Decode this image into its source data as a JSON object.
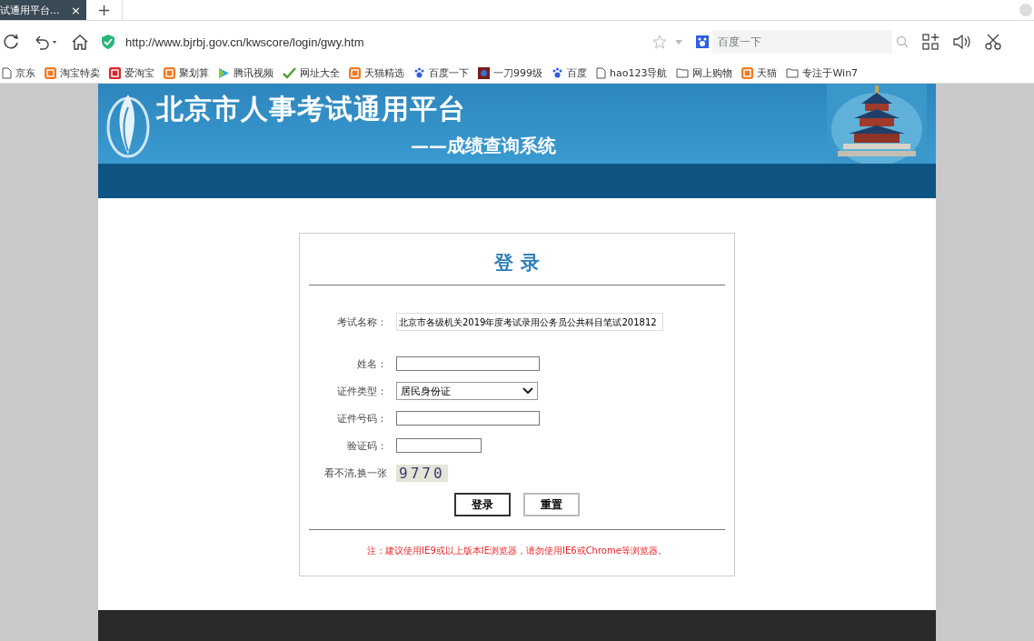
{
  "tab": {
    "title": "试通用平台...",
    "close": "×",
    "new_tab": "+"
  },
  "address_bar": {
    "url": "http://www.bjrbj.gov.cn/kwscore/login/gwy.htm"
  },
  "search": {
    "placeholder": "百度一下"
  },
  "bookmarks": [
    {
      "label": "京东",
      "kind": "page"
    },
    {
      "label": "淘宝特卖",
      "kind": "badge"
    },
    {
      "label": "爱淘宝",
      "kind": "red"
    },
    {
      "label": "聚划算",
      "kind": "badge"
    },
    {
      "label": "腾讯视频",
      "kind": "video"
    },
    {
      "label": "网址大全",
      "kind": "check"
    },
    {
      "label": "天猫精选",
      "kind": "badge"
    },
    {
      "label": "百度一下",
      "kind": "paw"
    },
    {
      "label": "一刀999级",
      "kind": "game"
    },
    {
      "label": "百度",
      "kind": "paw"
    },
    {
      "label": "hao123导航",
      "kind": "page"
    },
    {
      "label": "网上购物",
      "kind": "folder"
    },
    {
      "label": "天猫",
      "kind": "badge"
    },
    {
      "label": "专注于Win7",
      "kind": "folder"
    }
  ],
  "banner": {
    "title": "北京市人事考试通用平台",
    "subtitle": "——成绩查询系统"
  },
  "login": {
    "heading": "登 录",
    "fields": [
      {
        "label": "考试名称：",
        "kind": "readonly",
        "value": "北京市各级机关2019年度考试录用公务员公共科目笔试201812"
      },
      {
        "label": "姓名：",
        "kind": "text"
      },
      {
        "label": "证件类型：",
        "kind": "select",
        "value": "居民身份证"
      },
      {
        "label": "证件号码：",
        "kind": "text"
      },
      {
        "label": "验证码：",
        "kind": "short"
      },
      {
        "label": "看不清,换一张",
        "kind": "captcha",
        "value": "9770"
      }
    ],
    "buttons": [
      {
        "label": "登录",
        "selected": true
      },
      {
        "label": "重置",
        "selected": false
      }
    ],
    "note": "注：建议使用IE9或以上版本IE浏览器，请勿使用IE6或Chrome等浏览器。"
  }
}
